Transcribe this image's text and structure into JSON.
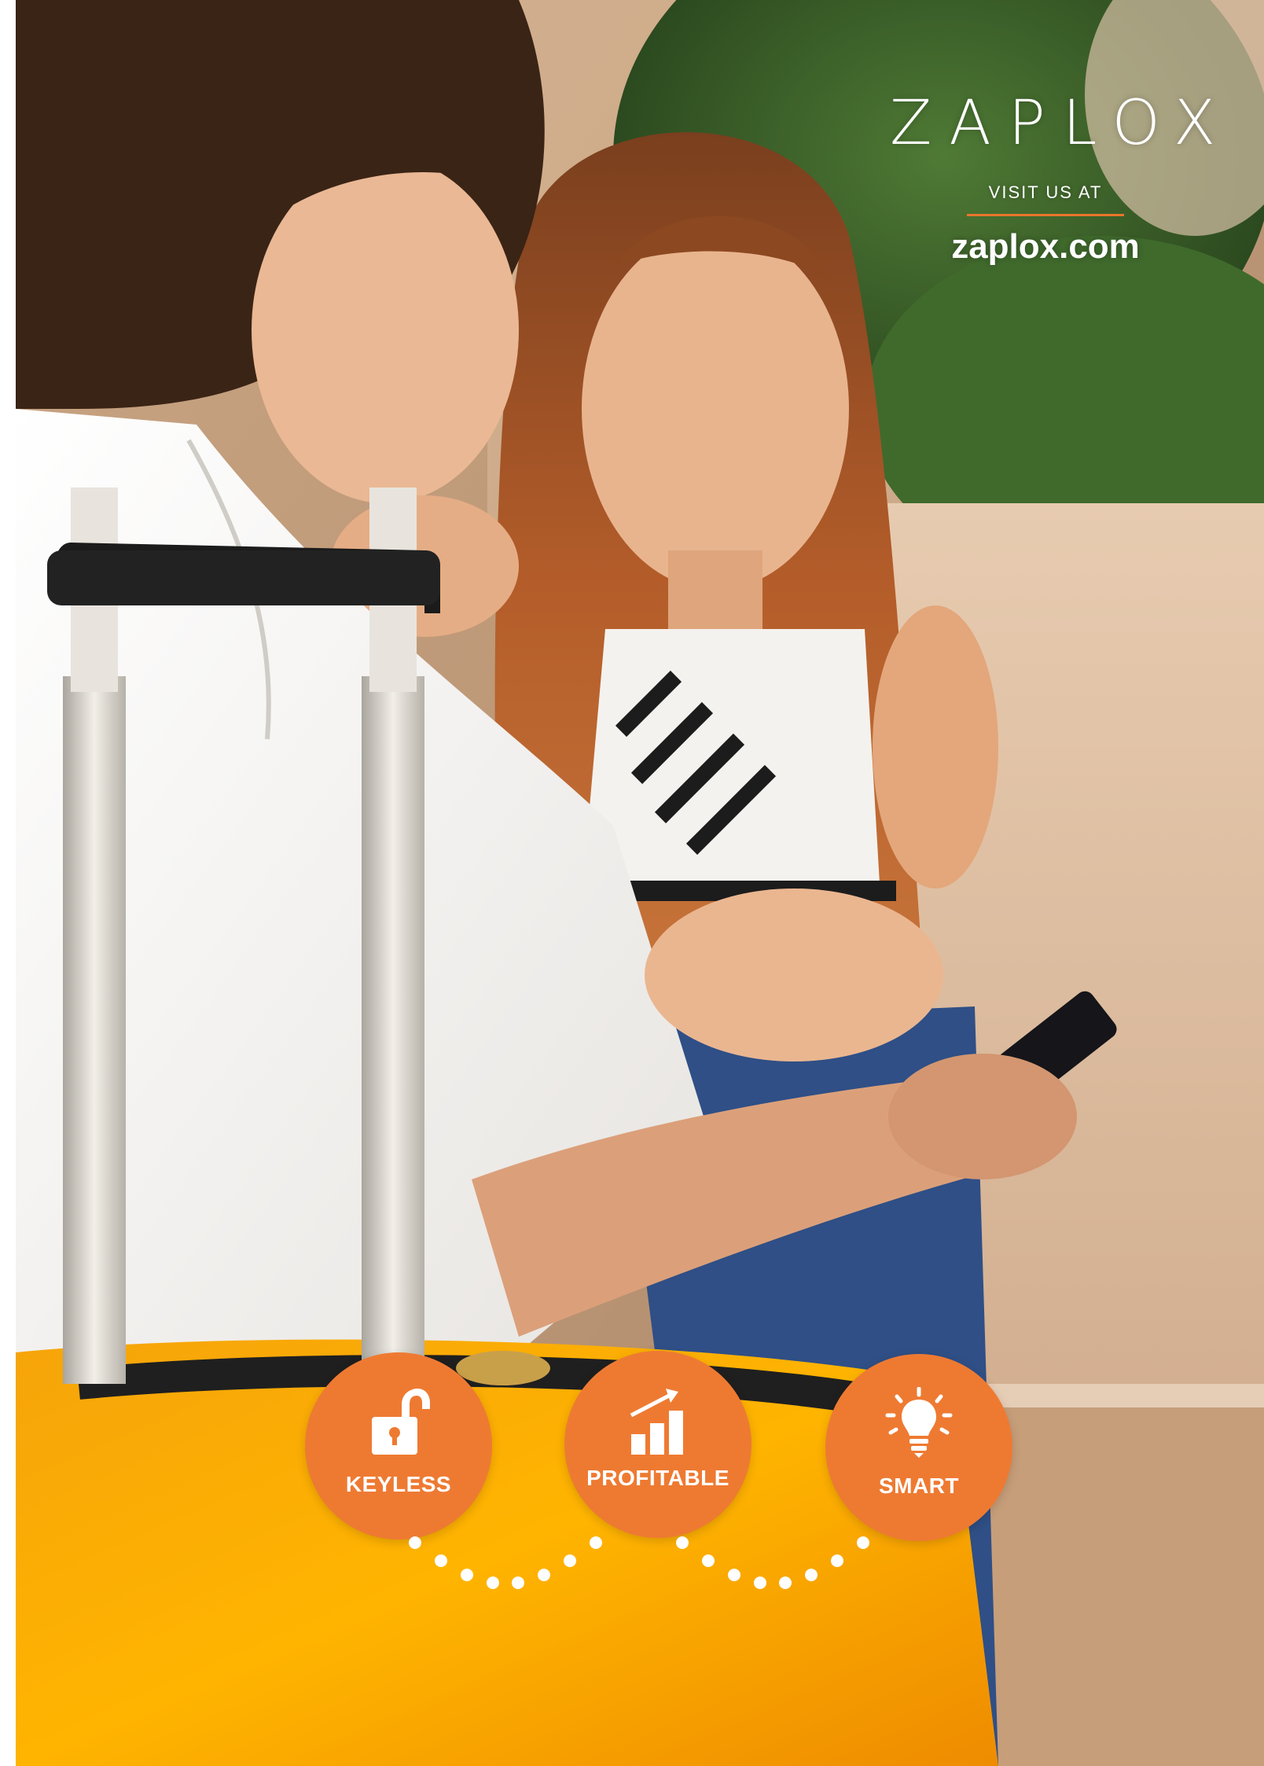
{
  "brand": {
    "logo": "ZAPLOX",
    "visit_label": "VISIT US AT",
    "website": "zaplox.com"
  },
  "features": [
    {
      "label": "KEYLESS",
      "icon": "unlocked-padlock-icon"
    },
    {
      "label": "PROFITABLE",
      "icon": "rising-bar-chart-icon"
    },
    {
      "label": "SMART",
      "icon": "lightbulb-icon"
    }
  ],
  "colors": {
    "accent": "#ee7a32",
    "rule": "#e8762c",
    "text": "#ffffff"
  }
}
